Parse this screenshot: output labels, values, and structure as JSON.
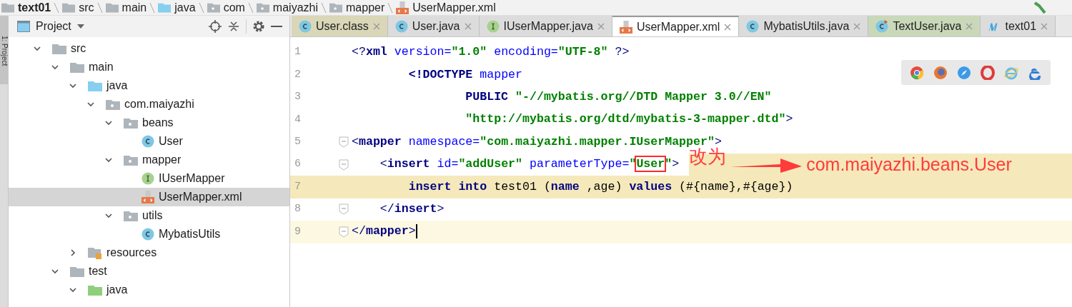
{
  "breadcrumbs": [
    {
      "label": "text01",
      "kind": "module"
    },
    {
      "label": "src",
      "kind": "folder"
    },
    {
      "label": "main",
      "kind": "folder"
    },
    {
      "label": "java",
      "kind": "source"
    },
    {
      "label": "com",
      "kind": "package"
    },
    {
      "label": "maiyazhi",
      "kind": "package"
    },
    {
      "label": "mapper",
      "kind": "package"
    },
    {
      "label": "UserMapper.xml",
      "kind": "xml"
    }
  ],
  "side_strip": {
    "label": "1: Project"
  },
  "project_panel": {
    "title": "Project",
    "tree": [
      {
        "label": "src",
        "kind": "folder",
        "expanded": true,
        "selected": false,
        "children": [
          {
            "label": "main",
            "kind": "folder",
            "expanded": true,
            "selected": false,
            "children": [
              {
                "label": "java",
                "kind": "source",
                "expanded": true,
                "selected": false,
                "children": [
                  {
                    "label": "com.maiyazhi",
                    "kind": "package",
                    "expanded": true,
                    "selected": false,
                    "children": [
                      {
                        "label": "beans",
                        "kind": "package",
                        "expanded": true,
                        "selected": false,
                        "children": [
                          {
                            "label": "User",
                            "kind": "class",
                            "selected": false
                          }
                        ]
                      },
                      {
                        "label": "mapper",
                        "kind": "package",
                        "expanded": true,
                        "selected": false,
                        "children": [
                          {
                            "label": "IUserMapper",
                            "kind": "interface",
                            "selected": false
                          },
                          {
                            "label": "UserMapper.xml",
                            "kind": "xml",
                            "selected": true
                          }
                        ]
                      },
                      {
                        "label": "utils",
                        "kind": "package",
                        "expanded": true,
                        "selected": false,
                        "children": [
                          {
                            "label": "MybatisUtils",
                            "kind": "class",
                            "selected": false
                          }
                        ]
                      }
                    ]
                  }
                ]
              },
              {
                "label": "resources",
                "kind": "resources",
                "expanded": false,
                "selected": false
              }
            ]
          },
          {
            "label": "test",
            "kind": "folder",
            "expanded": true,
            "selected": false,
            "children": [
              {
                "label": "java",
                "kind": "test",
                "expanded": true,
                "selected": false
              }
            ]
          }
        ]
      }
    ]
  },
  "tabs": [
    {
      "label": "User.class",
      "kind": "class",
      "selected": false,
      "color": "#d9d7b8"
    },
    {
      "label": "User.java",
      "kind": "class",
      "selected": false,
      "color": "#dcdcdc"
    },
    {
      "label": "IUserMapper.java",
      "kind": "interface",
      "selected": false,
      "color": "#dcdcdc"
    },
    {
      "label": "UserMapper.xml",
      "kind": "xml",
      "selected": true,
      "color": "#ffffff"
    },
    {
      "label": "MybatisUtils.java",
      "kind": "class",
      "selected": false,
      "color": "#dcdcdc"
    },
    {
      "label": "TextUser.java",
      "kind": "testclass",
      "selected": false,
      "color": "#c9d8b9"
    },
    {
      "label": "text01",
      "kind": "maven",
      "selected": false,
      "color": "#dcdcdc"
    }
  ],
  "editor": {
    "lines": [
      {
        "number": "1",
        "highlighted": false,
        "current": false,
        "segments": [
          {
            "text": "<?",
            "kind": "bracket"
          },
          {
            "text": "xml ",
            "kind": "tag"
          },
          {
            "text": "version=",
            "kind": "attr"
          },
          {
            "text": "\"1.0\"",
            "kind": "value"
          },
          {
            "text": " encoding=",
            "kind": "attr"
          },
          {
            "text": "\"UTF-8\"",
            "kind": "value"
          },
          {
            "text": " ?>",
            "kind": "bracket"
          }
        ]
      },
      {
        "number": "2",
        "highlighted": false,
        "current": false,
        "segments": [
          {
            "text": "<!DOCTYPE ",
            "kind": "tag"
          },
          {
            "text": "mapper",
            "kind": "attr"
          }
        ]
      },
      {
        "number": "3",
        "highlighted": false,
        "current": false,
        "segments": [
          {
            "text": "PUBLIC ",
            "kind": "tag"
          },
          {
            "text": "\"-//mybatis.org//DTD Mapper 3.0//EN\"",
            "kind": "value"
          }
        ]
      },
      {
        "number": "4",
        "highlighted": false,
        "current": false,
        "segments": [
          {
            "text": "\"http://mybatis.org/dtd/mybatis-3-mapper.dtd\"",
            "kind": "value"
          },
          {
            "text": ">",
            "kind": "bracket"
          }
        ]
      },
      {
        "number": "5",
        "highlighted": false,
        "current": false,
        "segments": [
          {
            "text": "<",
            "kind": "bracket"
          },
          {
            "text": "mapper",
            "kind": "tag"
          },
          {
            "text": " namespace=",
            "kind": "attr"
          },
          {
            "text": "\"com.maiyazhi.mapper.IUserMapper\"",
            "kind": "value"
          },
          {
            "text": ">",
            "kind": "bracket"
          }
        ]
      },
      {
        "number": "6",
        "highlighted": false,
        "current": false,
        "segments": [
          {
            "text": "<",
            "kind": "bracket"
          },
          {
            "text": "insert ",
            "kind": "tag"
          },
          {
            "text": "id=",
            "kind": "attr"
          },
          {
            "text": "\"addUser\"",
            "kind": "value"
          },
          {
            "text": " parameterType=",
            "kind": "attr"
          },
          {
            "text": "\"",
            "kind": "value"
          },
          {
            "text": "User",
            "kind": "value",
            "boxed": true
          },
          {
            "text": "\"",
            "kind": "value"
          },
          {
            "text": ">",
            "kind": "bracket"
          }
        ]
      },
      {
        "number": "7",
        "highlighted": true,
        "current": false,
        "segments": [
          {
            "text": "insert into ",
            "kind": "tag"
          },
          {
            "text": "test01 (",
            "kind": "text"
          },
          {
            "text": "name ",
            "kind": "tag"
          },
          {
            "text": ",age) ",
            "kind": "text"
          },
          {
            "text": "values ",
            "kind": "tag"
          },
          {
            "text": "(#{name},#{age})",
            "kind": "text"
          }
        ]
      },
      {
        "number": "8",
        "highlighted": false,
        "current": false,
        "segments": [
          {
            "text": "</",
            "kind": "bracket"
          },
          {
            "text": "insert",
            "kind": "tag"
          },
          {
            "text": ">",
            "kind": "bracket"
          }
        ]
      },
      {
        "number": "9",
        "highlighted": false,
        "current": true,
        "segments": [
          {
            "text": "</",
            "kind": "bracket"
          },
          {
            "text": "mapper",
            "kind": "tag"
          },
          {
            "text": ">",
            "kind": "bracket"
          }
        ]
      }
    ],
    "annotation": {
      "label": "改为",
      "replacement": "com.maiyazhi.beans.User"
    }
  }
}
